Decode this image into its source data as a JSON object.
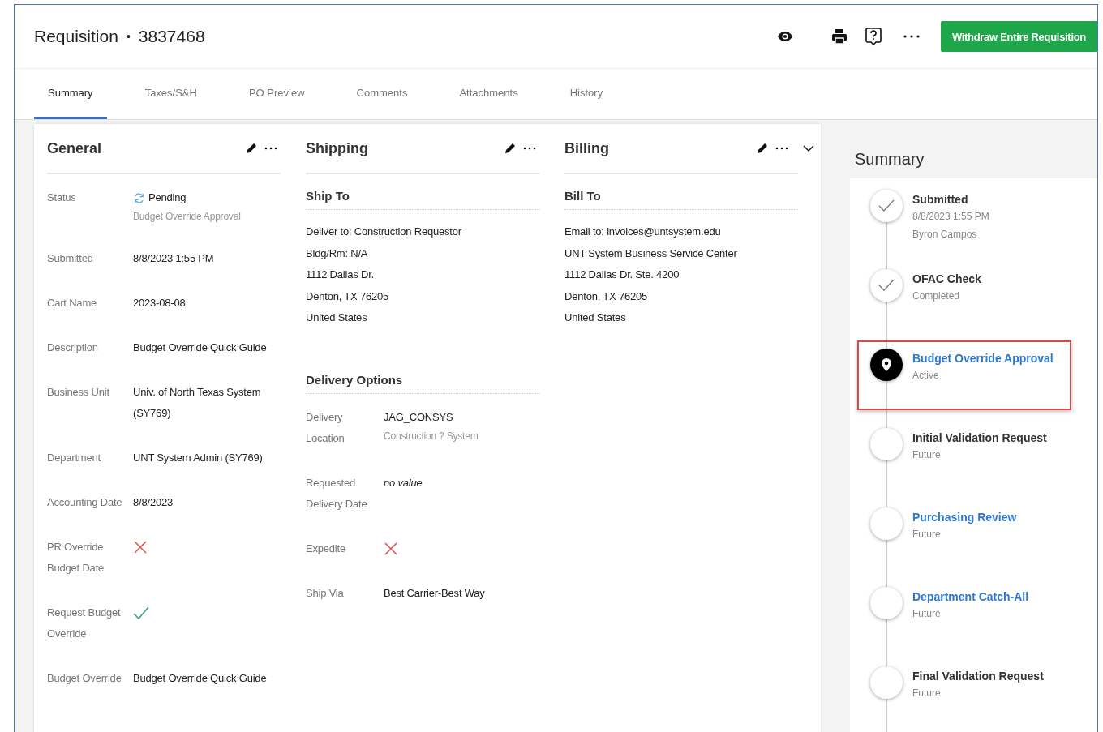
{
  "header": {
    "title": "Requisition",
    "separator": "•",
    "number": "3837468",
    "action": "Withdraw Entire Requisition"
  },
  "tabs": [
    {
      "label": "Summary",
      "selected": true
    },
    {
      "label": "Taxes/S&H",
      "selected": false
    },
    {
      "label": "PO Preview",
      "selected": false
    },
    {
      "label": "Comments",
      "selected": false
    },
    {
      "label": "Attachments",
      "selected": false
    },
    {
      "label": "History",
      "selected": false
    }
  ],
  "general": {
    "title": "General",
    "fields": [
      {
        "kind": "status",
        "label": "Status",
        "value": "Pending",
        "sub": "Budget Override Approval"
      },
      {
        "kind": "text",
        "label": "Submitted",
        "value": "8/8/2023 1:55 PM"
      },
      {
        "kind": "text",
        "label": "Cart Name",
        "value": "2023-08-08"
      },
      {
        "kind": "text",
        "label": "Description",
        "value": "Budget Override Quick Guide"
      },
      {
        "kind": "text",
        "label": "Business Unit",
        "value": "Univ. of North Texas System (SY769)"
      },
      {
        "kind": "text",
        "label": "Department",
        "value": "UNT System Admin (SY769)"
      },
      {
        "kind": "text",
        "label": "Accounting Date",
        "value": "8/8/2023"
      },
      {
        "kind": "flag",
        "label": "PR Override Budget Date",
        "checked": false
      },
      {
        "kind": "flag",
        "label": "Request Budget Override",
        "checked": true
      },
      {
        "kind": "text",
        "label": "Budget Override",
        "value": "Budget Override Quick Guide"
      }
    ]
  },
  "shipping": {
    "title": "Shipping",
    "ship_to": {
      "heading": "Ship To",
      "lines": [
        "Deliver to: Construction Requestor",
        "Bldg/Rm: N/A",
        "1112 Dallas Dr.",
        "Denton, TX 76205",
        "United States"
      ]
    },
    "delivery_options": {
      "heading": "Delivery Options",
      "fields": [
        {
          "kind": "text",
          "label": "Delivery Location",
          "value": "JAG_CONSYS",
          "sub": "Construction ? System"
        },
        {
          "kind": "empty",
          "label": "Requested Delivery Date",
          "value": "no value"
        },
        {
          "kind": "flag",
          "label": "Expedite",
          "checked": false
        },
        {
          "kind": "text",
          "label": "Ship Via",
          "value": "Best Carrier-Best Way"
        }
      ]
    }
  },
  "billing": {
    "title": "Billing",
    "bill_to": {
      "heading": "Bill To",
      "lines": [
        "Email to: invoices@untsystem.edu",
        "UNT System Business Service Center",
        "1112 Dallas Dr. Ste. 4200",
        "Denton, TX 76205",
        "United States"
      ]
    }
  },
  "summary": {
    "title": "Summary",
    "steps": [
      {
        "name": "Submitted",
        "kind": "done",
        "link": false,
        "highlighted": false,
        "details": [
          "8/8/2023 1:55 PM",
          "Byron Campos"
        ]
      },
      {
        "name": "OFAC Check",
        "kind": "done",
        "link": false,
        "highlighted": false,
        "details": [
          "Completed"
        ]
      },
      {
        "name": "Budget Override Approval",
        "kind": "active",
        "link": true,
        "highlighted": true,
        "details": [
          "Active"
        ]
      },
      {
        "name": "Initial Validation Request",
        "kind": "future",
        "link": false,
        "highlighted": false,
        "details": [
          "Future"
        ]
      },
      {
        "name": "Purchasing Review",
        "kind": "future",
        "link": true,
        "highlighted": false,
        "details": [
          "Future"
        ]
      },
      {
        "name": "Department Catch-All",
        "kind": "future",
        "link": true,
        "highlighted": false,
        "details": [
          "Future"
        ]
      },
      {
        "name": "Final Validation Request",
        "kind": "future",
        "link": false,
        "highlighted": false,
        "details": [
          "Future"
        ]
      }
    ]
  }
}
